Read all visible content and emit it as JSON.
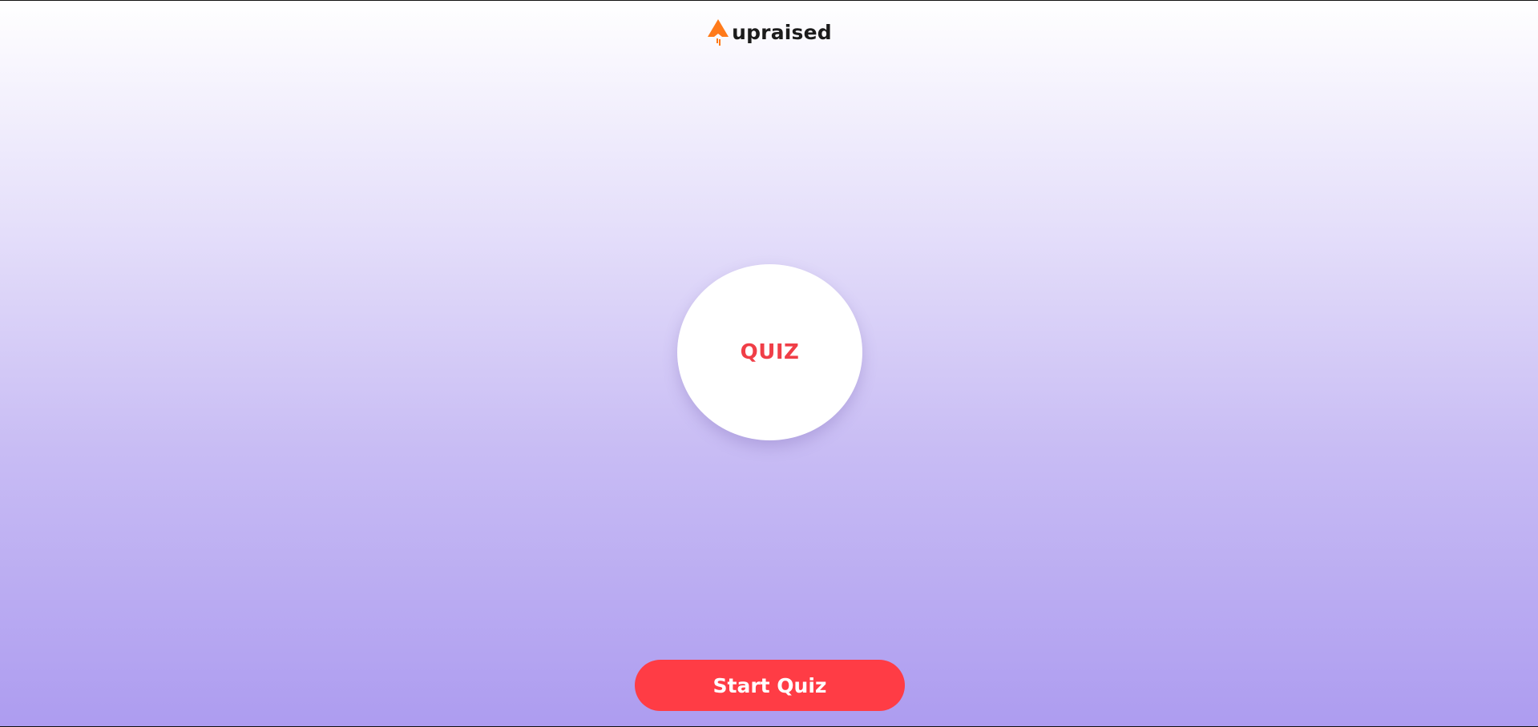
{
  "header": {
    "logo_icon": "rocket-arrow-icon",
    "brand_name": "upraised",
    "brand_color": "#ff7a1a"
  },
  "main": {
    "badge_label": "QUIZ",
    "badge_label_color": "#f03e47"
  },
  "footer": {
    "start_button_label": "Start Quiz",
    "start_button_color": "#ff3c45"
  },
  "theme": {
    "background_top": "#ffffff",
    "background_bottom": "#ad9cf0"
  }
}
